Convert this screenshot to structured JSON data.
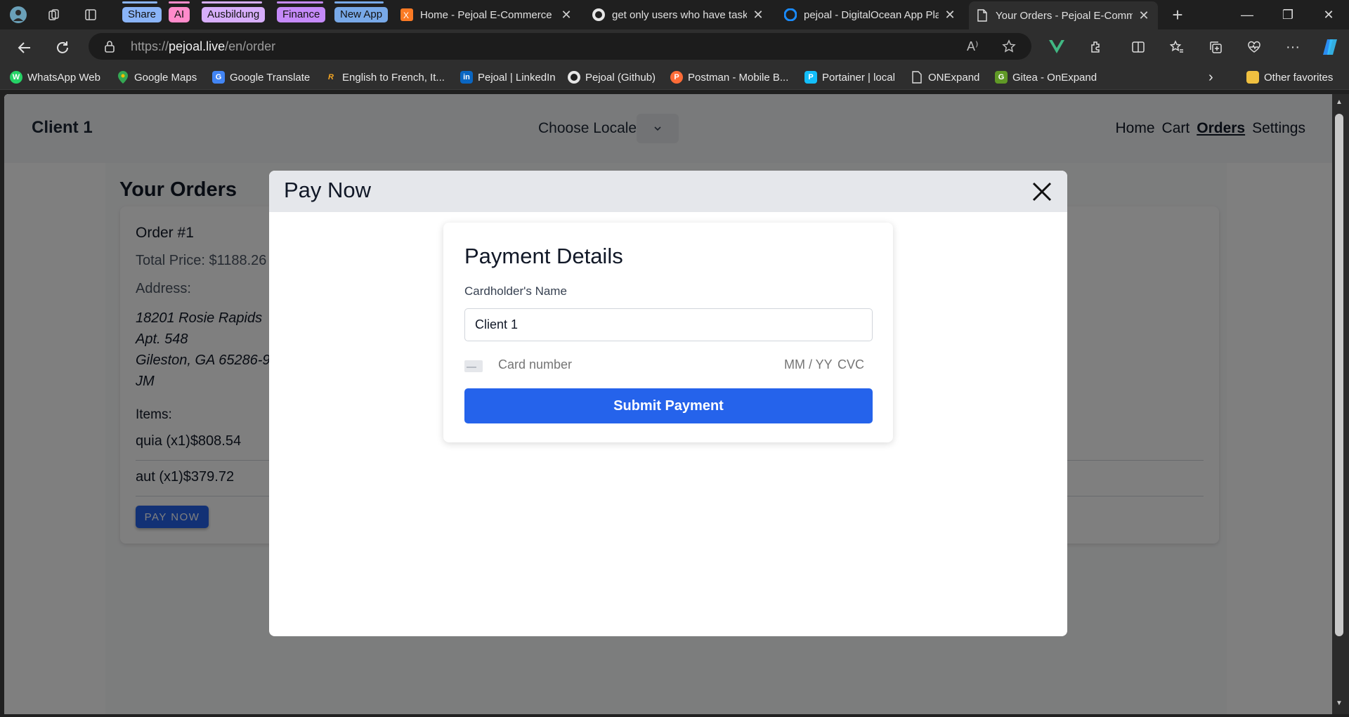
{
  "browser": {
    "tab_groups": [
      {
        "label": "Share",
        "color": "#8ab4f8"
      },
      {
        "label": "AI",
        "color": "#ff8bcb"
      },
      {
        "label": "Ausbildung",
        "color": "#d7aefb"
      },
      {
        "label": "Finance",
        "color": "#c58af9"
      },
      {
        "label": "New App",
        "color": "#78a9e8"
      }
    ],
    "tabs": [
      {
        "title": "Home - Pejoal E-Commerce",
        "icon": "xampp-icon"
      },
      {
        "title": "get only users who have tasks",
        "icon": "github-icon"
      },
      {
        "title": "pejoal - DigitalOcean App Pla",
        "icon": "digitalocean-icon"
      },
      {
        "title": "Your Orders - Pejoal E-Comm",
        "icon": "page-icon"
      }
    ],
    "address": {
      "prefix": "https://",
      "host": "pejoal.live",
      "path": "/en/order"
    },
    "bookmarks": [
      {
        "label": "WhatsApp Web",
        "color": "#25d366",
        "glyph": "W"
      },
      {
        "label": "Google Maps",
        "color": "#34a853",
        "glyph": "M"
      },
      {
        "label": "Google Translate",
        "color": "#4285f4",
        "glyph": "G"
      },
      {
        "label": "English to French, It...",
        "color": "#f5a623",
        "glyph": "R"
      },
      {
        "label": "Pejoal | LinkedIn",
        "color": "#0a66c2",
        "glyph": "in"
      },
      {
        "label": "Pejoal (Github)",
        "color": "#333333",
        "glyph": "GH"
      },
      {
        "label": "Postman - Mobile B...",
        "color": "#ff6c37",
        "glyph": "P"
      },
      {
        "label": "Portainer | local",
        "color": "#13bef9",
        "glyph": "P"
      },
      {
        "label": "ONExpand",
        "color": "#555555",
        "glyph": "O"
      },
      {
        "label": "Gitea - OnExpand",
        "color": "#609926",
        "glyph": "G"
      }
    ],
    "other_favorites": "Other favorites"
  },
  "app": {
    "brand": "Client 1",
    "locale_label": "Choose Locale",
    "nav": [
      "Home",
      "Cart",
      "Orders",
      "Settings"
    ],
    "current_nav": "Orders"
  },
  "orders": {
    "title": "Your Orders",
    "order": {
      "number": "Order #1",
      "total": "Total Price: $1188.26",
      "address_label": "Address:",
      "address_lines": [
        "18201 Rosie Rapids",
        "Apt. 548",
        "Gileston, GA 65286-9",
        "JM"
      ],
      "items_label": "Items:",
      "items": [
        "quia (x1)$808.54",
        "aut (x1)$379.72"
      ],
      "pay_label": "PAY NOW"
    }
  },
  "modal": {
    "title": "Pay Now",
    "heading": "Payment Details",
    "cardholder_label": "Cardholder's Name",
    "cardholder_value": "Client 1",
    "card_number_placeholder": "Card number",
    "card_exp_placeholder": "MM / YY",
    "card_cvc_placeholder": "CVC",
    "submit_label": "Submit Payment",
    "accent": "#2563eb"
  }
}
